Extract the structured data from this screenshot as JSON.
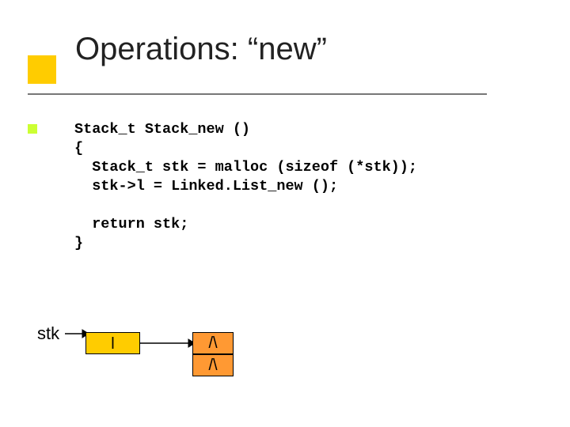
{
  "title": "Operations: “new”",
  "code": {
    "line1": "Stack_t Stack_new ()",
    "line2": "{",
    "line3": "  Stack_t stk = malloc (sizeof (*stk));",
    "line4": "  stk->l = Linked.List_new ();",
    "line5": "",
    "line6": "  return stk;",
    "line7": "}"
  },
  "diagram": {
    "stk_label": "stk",
    "l_label": "l",
    "null1": "/\\",
    "null2": "/\\"
  }
}
